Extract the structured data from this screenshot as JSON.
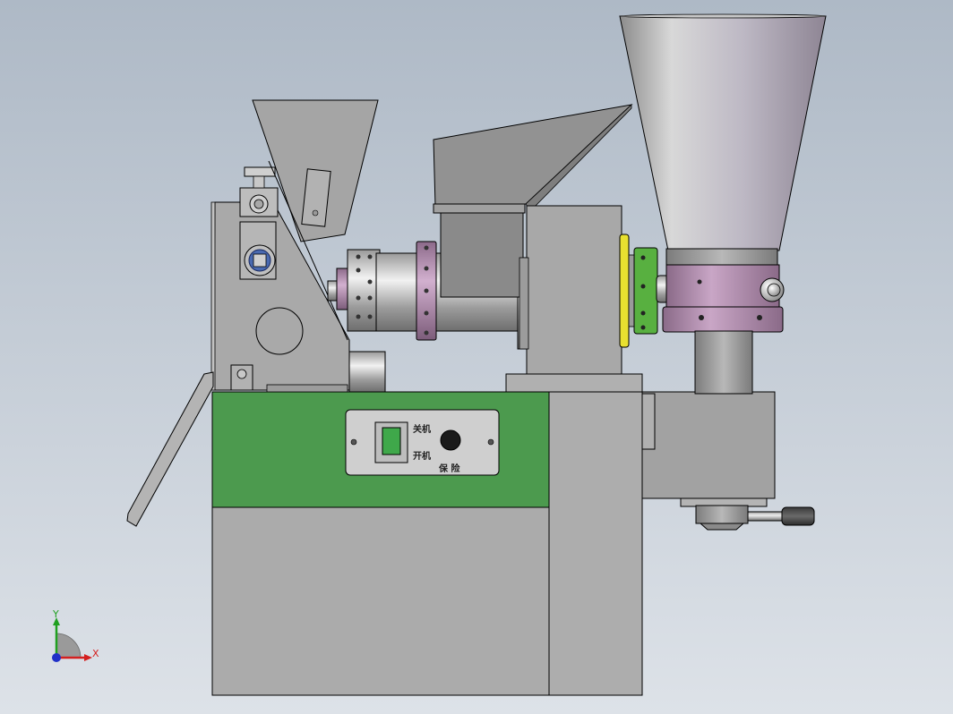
{
  "viewport": {
    "background_top": "#aeb9c6",
    "background_bottom": "#dde2e8"
  },
  "control_panel": {
    "label_off": "关机",
    "label_on": "开机",
    "label_protect": "保 险"
  },
  "triad": {
    "x_label": "X",
    "y_label": "Y"
  },
  "colors": {
    "cabinet_green": "#4c9a4e",
    "cabinet_gray": "#a9a9a9",
    "flange_purple": "#b48cb0",
    "ring_yellow": "#e8e030",
    "ring_green": "#58b040",
    "axis_x": "#d42020",
    "axis_y": "#20a020",
    "axis_z": "#2030c8"
  },
  "icons": {
    "switch": "rocker-switch-icon",
    "knob": "rotary-knob-icon",
    "triad": "coordinate-triad-icon"
  }
}
